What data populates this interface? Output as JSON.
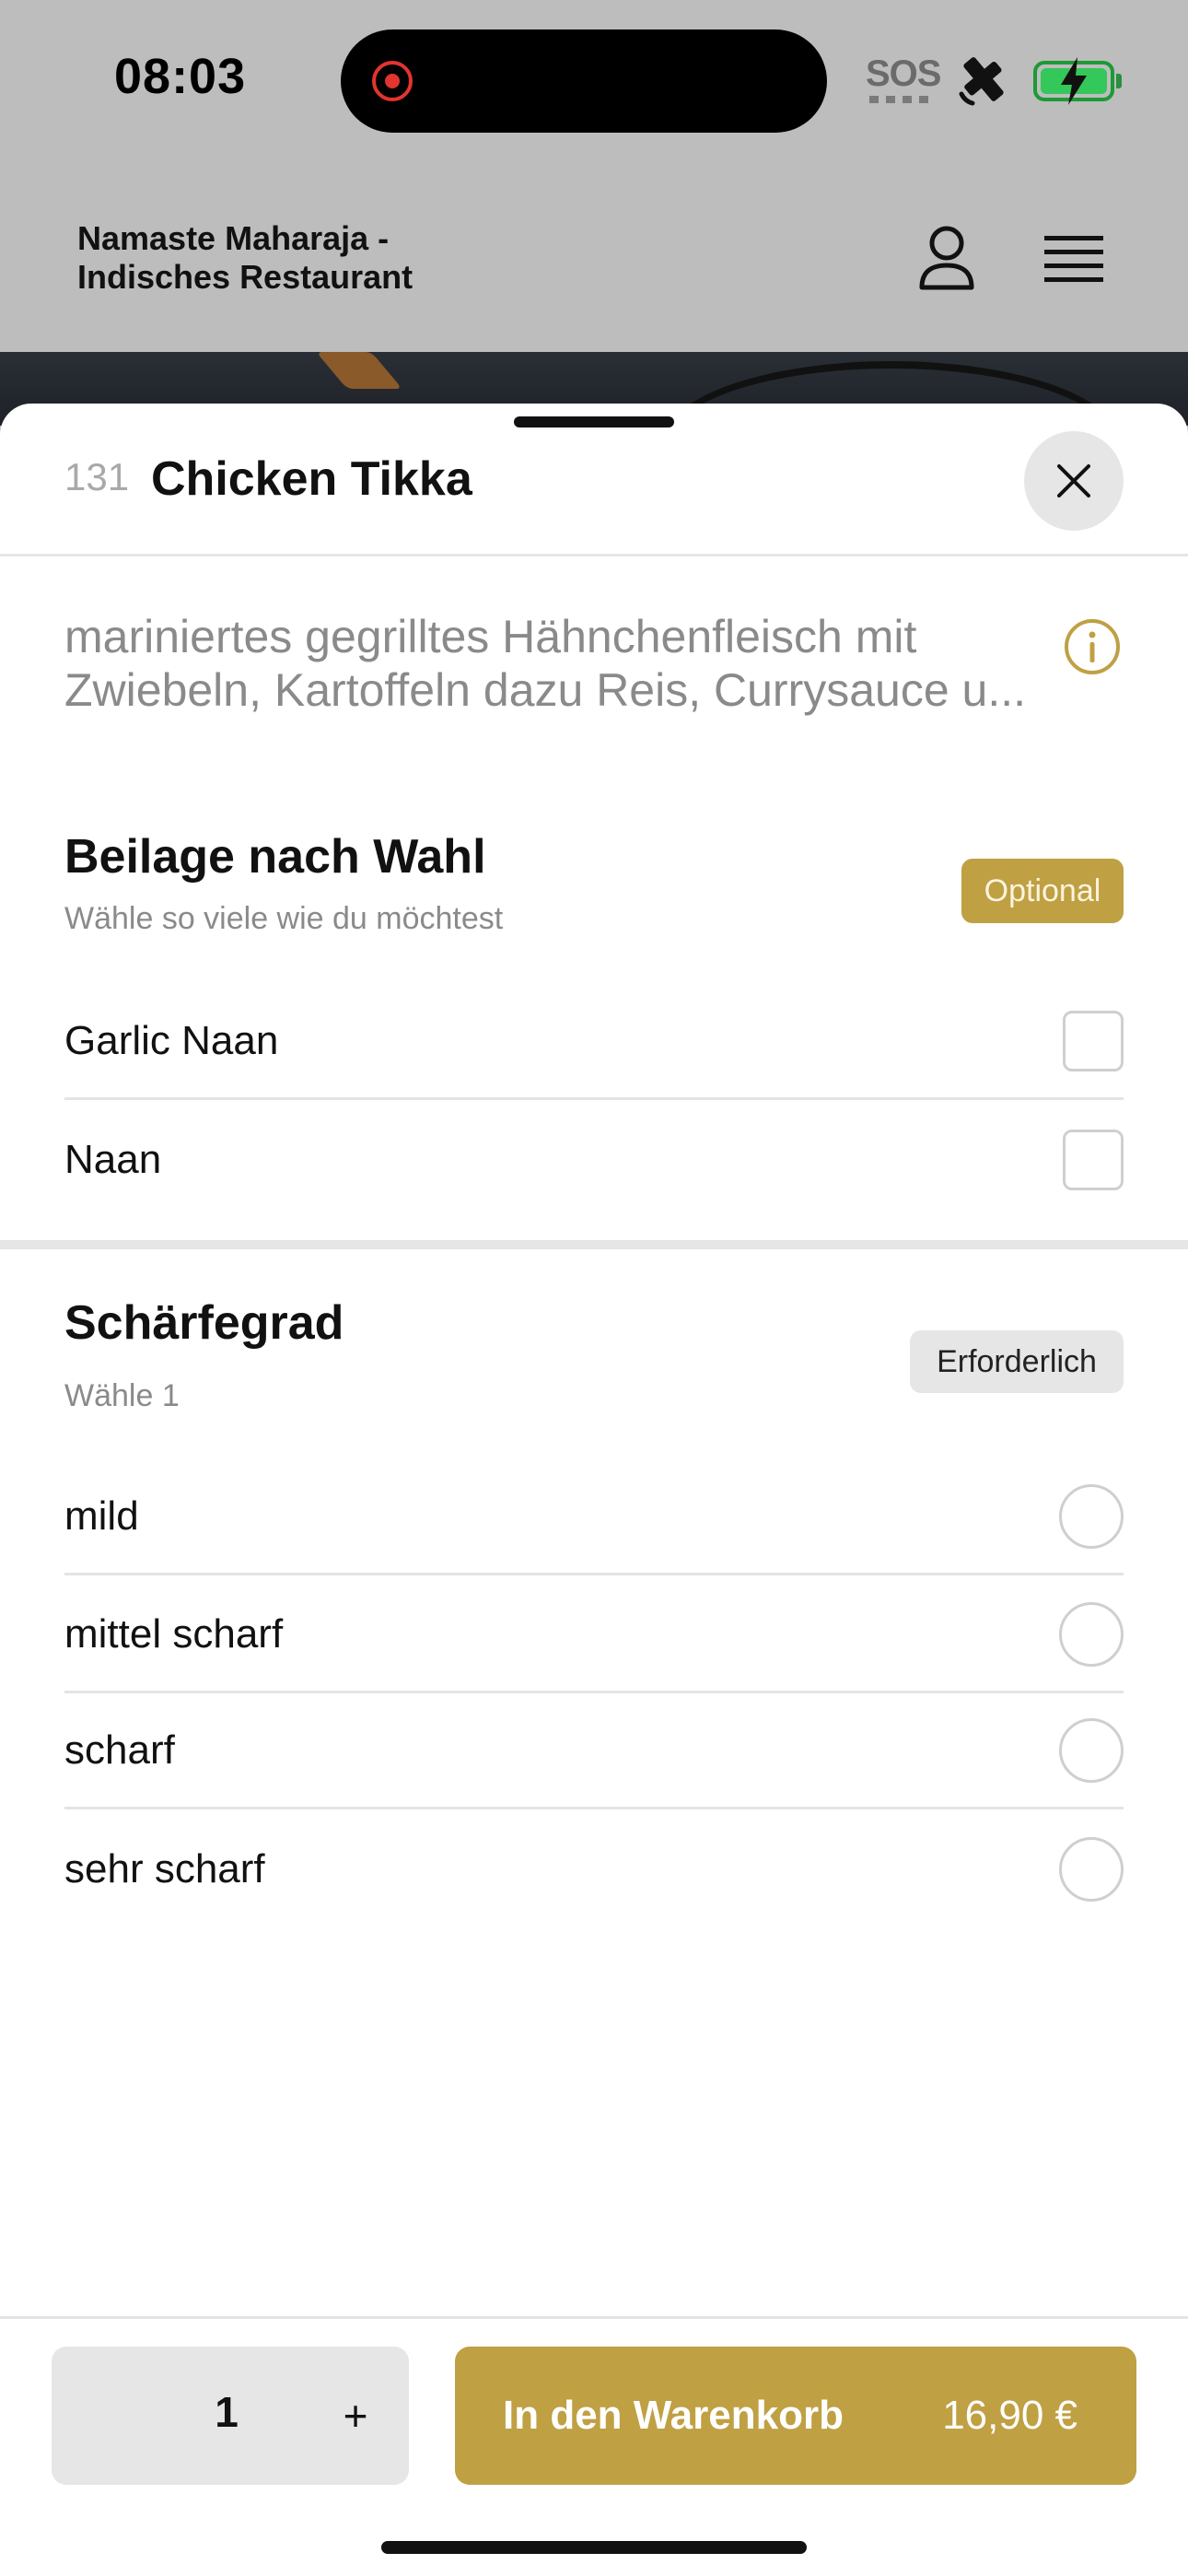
{
  "status_bar": {
    "time": "08:03",
    "sos_label": "SOS",
    "icons": [
      "recording-icon",
      "satellite-icon",
      "battery-charging-icon"
    ]
  },
  "header": {
    "restaurant_name_line1": "Namaste Maharaja -",
    "restaurant_name_line2": "Indisches Restaurant",
    "icons": [
      "user-icon",
      "hamburger-menu-icon"
    ]
  },
  "item": {
    "number": "131",
    "title": "Chicken Tikka",
    "description_line1": "mariniertes gegrilltes Hähnchenfleisch mit",
    "description_line2": "Zwiebeln, Kartoffeln dazu Reis, Currysauce u..."
  },
  "sections": [
    {
      "title": "Beilage nach Wahl",
      "subtitle": "Wähle so viele wie du möchtest",
      "badge": "Optional",
      "options": [
        {
          "label": "Garlic Naan",
          "checked": false
        },
        {
          "label": "Naan",
          "checked": false
        }
      ]
    },
    {
      "title": "Schärfegrad",
      "subtitle": "Wähle 1",
      "badge": "Erforderlich",
      "options": [
        {
          "label": "mild",
          "selected": false
        },
        {
          "label": "mittel scharf",
          "selected": false
        },
        {
          "label": "scharf",
          "selected": false
        },
        {
          "label": "sehr scharf",
          "selected": false
        }
      ]
    }
  ],
  "footer": {
    "quantity": "1",
    "plus_label": "+",
    "cart_label": "In den Warenkorb",
    "price": "16,90 €"
  },
  "colors": {
    "accent": "#bfa043",
    "badge_gray": "#e6e6e6",
    "text_muted": "#8a8a8a",
    "battery_green": "#34c759"
  }
}
